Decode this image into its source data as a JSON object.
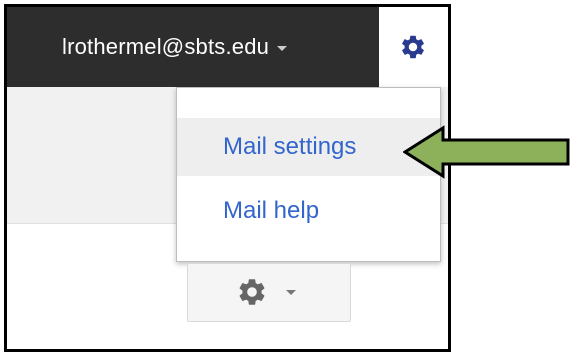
{
  "header": {
    "account_email": "lrothermel@sbts.edu",
    "settings_icon": "gear-icon",
    "accent_color": "#2a3b8f"
  },
  "menu": {
    "items": [
      {
        "label": "Mail settings",
        "highlighted": true
      },
      {
        "label": "Mail help",
        "highlighted": false
      }
    ],
    "link_color": "#3366cc"
  },
  "toolbar": {
    "settings_icon": "gear-icon"
  },
  "annotation": {
    "arrow_color": "#8db15b"
  }
}
